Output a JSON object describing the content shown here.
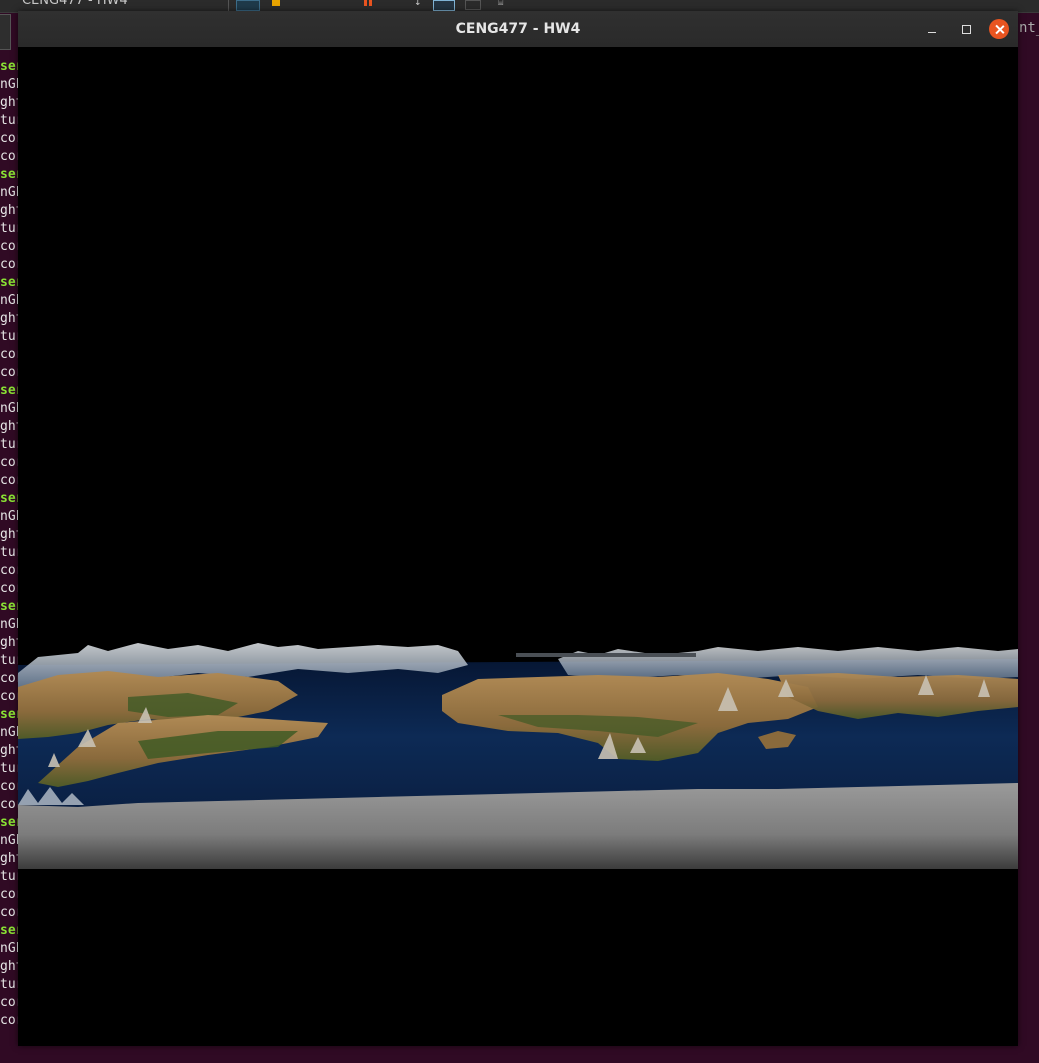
{
  "background": {
    "tab_title": "CENG477 - HW4",
    "right_suffix": "nt_",
    "terminal_prompt_fragment": "ser",
    "terminal_output_fragments": [
      "nGL",
      "ght",
      "tur",
      "cor",
      "cor"
    ]
  },
  "window": {
    "title": "CENG477 - HW4",
    "controls": {
      "minimize": "minimize",
      "maximize": "maximize",
      "close": "close"
    }
  },
  "viewport": {
    "content": "rendered-terrain",
    "colors": {
      "background": "#000000",
      "ocean": "#0d2a55",
      "land": "#8a6a3c",
      "vegetation": "#3f5a25",
      "ice": "#8a8a8a",
      "snow": "#d8dde3"
    }
  }
}
